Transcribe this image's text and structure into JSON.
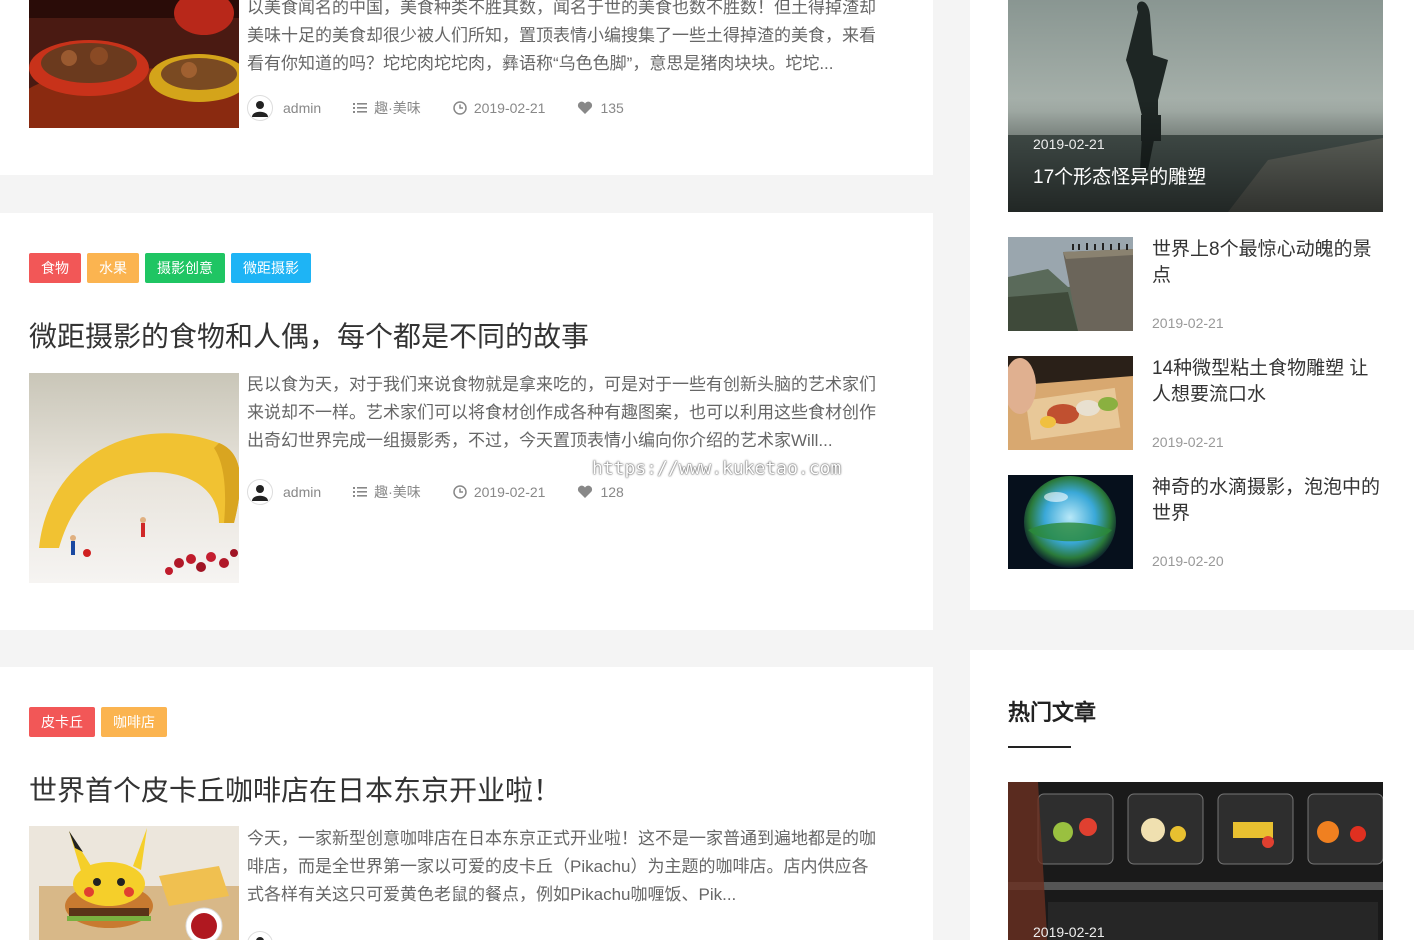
{
  "posts": [
    {
      "excerpt_lines": [
        "以美食闻名的中国，美食种类不胜其数，闻名于世的美食也数不胜数！但土得掉渣却",
        "美味十足的美食却很少被人们所知，置顶表情小编搜集了一些土得掉渣的美食，来看",
        "看有你知道的吗？坨坨肉坨坨肉，彝语称“乌色色脚”，意思是猪肉块块。坨坨..."
      ],
      "author": "admin",
      "category": "趣·美味",
      "date": "2019-02-21",
      "likes": "135"
    },
    {
      "tags": [
        {
          "label": "食物",
          "color": "#f25757"
        },
        {
          "label": "水果",
          "color": "#fbb450"
        },
        {
          "label": "摄影创意",
          "color": "#1fc563"
        },
        {
          "label": "微距摄影",
          "color": "#1eb4f5"
        }
      ],
      "title": "微距摄影的食物和人偶，每个都是不同的故事",
      "excerpt_lines": [
        "民以食为天，对于我们来说食物就是拿来吃的，可是对于一些有创新头脑的艺术家们",
        "来说却不一样。艺术家们可以将食材创作成各种有趣图案，也可以利用这些食材创作",
        "出奇幻世界完成一组摄影秀，不过，今天置顶表情小编向你介绍的艺术家Will..."
      ],
      "author": "admin",
      "category": "趣·美味",
      "date": "2019-02-21",
      "likes": "128"
    },
    {
      "tags": [
        {
          "label": "皮卡丘",
          "color": "#f25757"
        },
        {
          "label": "咖啡店",
          "color": "#fbb450"
        }
      ],
      "title": "世界首个皮卡丘咖啡店在日本东京开业啦！",
      "excerpt_lines": [
        "今天，一家新型创意咖啡店在日本东京正式开业啦！这不是一家普通到遍地都是的咖",
        "啡店，而是全世界第一家以可爱的皮卡丘（Pikachu）为主题的咖啡店。店内供应各",
        "式各样有关这只可爱黄色老鼠的餐点，例如Pikachu咖喱饭、Pik..."
      ]
    }
  ],
  "watermark": "https://www.kuketao.com",
  "sidebar": {
    "feature": {
      "date": "2019-02-21",
      "title": "17个形态怪异的雕塑"
    },
    "items": [
      {
        "title": "世界上8个最惊心动魄的景点",
        "date": "2019-02-21"
      },
      {
        "title": "14种微型粘土食物雕塑 让人想要流口水",
        "date": "2019-02-21"
      },
      {
        "title": "神奇的水滴摄影，泡泡中的世界",
        "date": "2019-02-20"
      }
    ],
    "hot": {
      "title": "热门文章",
      "feature": {
        "date": "2019-02-21"
      }
    }
  }
}
